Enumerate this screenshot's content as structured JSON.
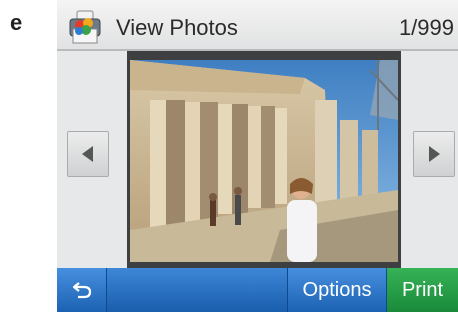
{
  "figure_label": "e",
  "header": {
    "title": "View Photos",
    "counter": "1/999",
    "app_icon": "photo-app-icon"
  },
  "navigation": {
    "prev_icon": "left-arrow-icon",
    "next_icon": "right-arrow-icon"
  },
  "toolbar": {
    "back_icon": "back-arrow-icon",
    "options_label": "Options",
    "print_label": "Print"
  },
  "colors": {
    "toolbar_blue": "#2a72c4",
    "print_green": "#25a047",
    "header_bg": "#e9eaeb",
    "frame": "#3e3f40"
  }
}
